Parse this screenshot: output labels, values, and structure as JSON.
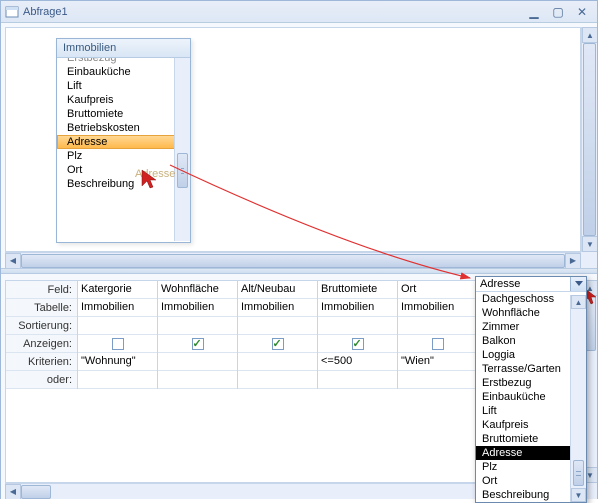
{
  "window": {
    "title": "Abfrage1"
  },
  "fieldlist": {
    "title": "Immobilien",
    "items": [
      "Erstbezug",
      "Einbauküche",
      "Lift",
      "Kaufpreis",
      "Bruttomiete",
      "Betriebskosten",
      "Adresse",
      "Plz",
      "Ort",
      "Beschreibung"
    ],
    "selected": "Adresse",
    "drag_ghost": "Adresse"
  },
  "grid": {
    "rowlabels": {
      "field": "Feld:",
      "table": "Tabelle:",
      "sort": "Sortierung:",
      "show": "Anzeigen:",
      "criteria": "Kriterien:",
      "or": "oder:"
    },
    "columns": [
      {
        "field": "Katergorie",
        "table": "Immobilien",
        "show": false,
        "criteria": "\"Wohnung\""
      },
      {
        "field": "Wohnfläche",
        "table": "Immobilien",
        "show": true,
        "criteria": ""
      },
      {
        "field": "Alt/Neubau",
        "table": "Immobilien",
        "show": true,
        "criteria": ""
      },
      {
        "field": "Bruttomiete",
        "table": "Immobilien",
        "show": true,
        "criteria": "<=500"
      },
      {
        "field": "Ort",
        "table": "Immobilien",
        "show": false,
        "criteria": "\"Wien\""
      }
    ]
  },
  "dropdown": {
    "value": "Adresse",
    "options": [
      "Dachgeschoss",
      "Wohnfläche",
      "Zimmer",
      "Balkon",
      "Loggia",
      "Terrasse/Garten",
      "Erstbezug",
      "Einbauküche",
      "Lift",
      "Kaufpreis",
      "Bruttomiete",
      "Adresse",
      "Plz",
      "Ort",
      "Beschreibung"
    ],
    "selected": "Adresse"
  }
}
